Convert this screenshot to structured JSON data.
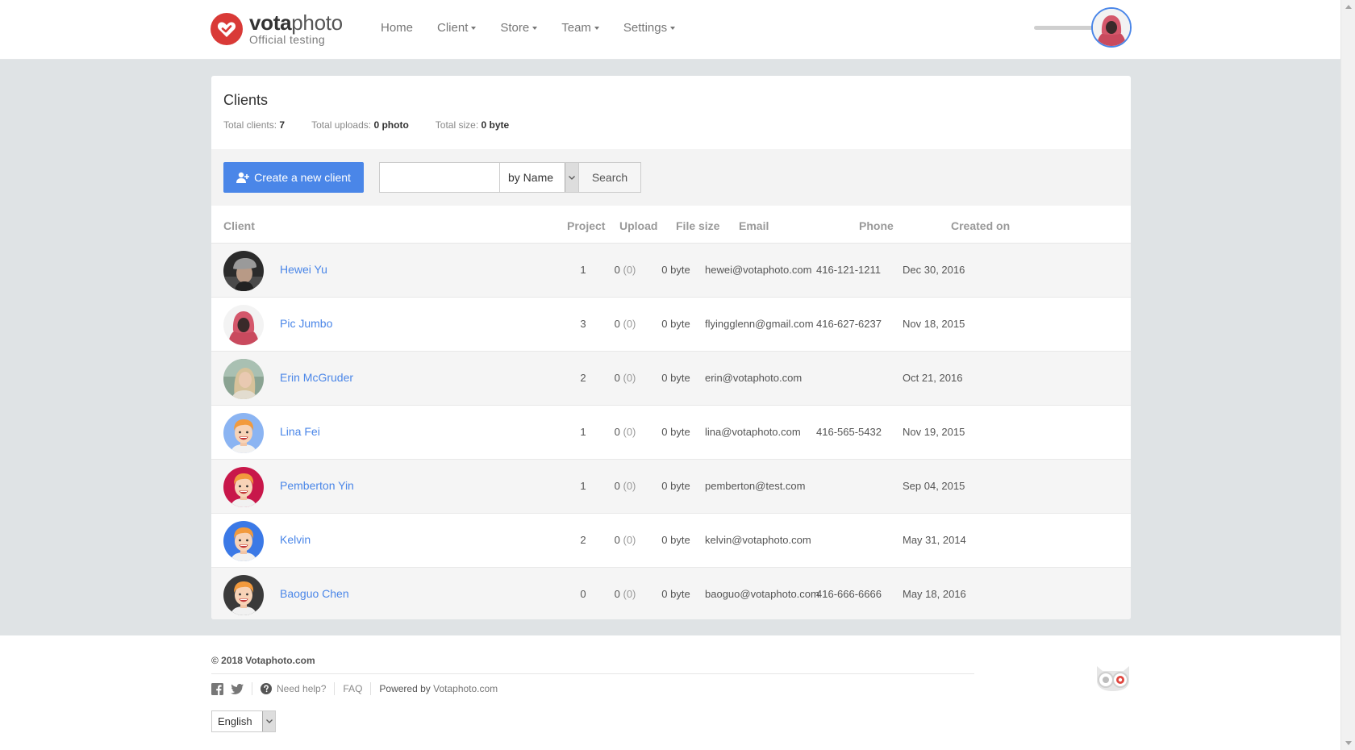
{
  "brand": {
    "name_bold": "vota",
    "name_light": "photo",
    "subtitle": "Official testing"
  },
  "nav": [
    {
      "label": "Home",
      "dropdown": false
    },
    {
      "label": "Client",
      "dropdown": true
    },
    {
      "label": "Store",
      "dropdown": true
    },
    {
      "label": "Team",
      "dropdown": true
    },
    {
      "label": "Settings",
      "dropdown": true
    }
  ],
  "page": {
    "title": "Clients",
    "stats": {
      "clients_label": "Total clients:",
      "clients_value": "7",
      "uploads_label": "Total uploads:",
      "uploads_value": "0 photo",
      "size_label": "Total size:",
      "size_value": "0 byte"
    }
  },
  "toolbar": {
    "create_label": "Create a new client",
    "search_value": "",
    "search_by": "by Name",
    "search_label": "Search"
  },
  "table": {
    "columns": [
      "Client",
      "Project",
      "Upload",
      "File size",
      "Email",
      "Phone",
      "Created on"
    ],
    "rows": [
      {
        "name": "Hewei Yu",
        "project": "1",
        "upload_count": "0",
        "upload_paren": "(0)",
        "file_size": "0 byte",
        "email": "hewei@votaphoto.com",
        "phone": "416-121-1211",
        "created": "Dec 30, 2016",
        "avatar": "photo-man-cap"
      },
      {
        "name": "Pic Jumbo",
        "project": "3",
        "upload_count": "0",
        "upload_paren": "(0)",
        "file_size": "0 byte",
        "email": "flyingglenn@gmail.com",
        "phone": "416-627-6237",
        "created": "Nov 18, 2015",
        "avatar": "photo-pink-hood"
      },
      {
        "name": "Erin McGruder",
        "project": "2",
        "upload_count": "0",
        "upload_paren": "(0)",
        "file_size": "0 byte",
        "email": "erin@votaphoto.com",
        "phone": "",
        "created": "Oct 21, 2016",
        "avatar": "photo-woman"
      },
      {
        "name": "Lina Fei",
        "project": "1",
        "upload_count": "0",
        "upload_paren": "(0)",
        "file_size": "0 byte",
        "email": "lina@votaphoto.com",
        "phone": "416-565-5432",
        "created": "Nov 19, 2015",
        "avatar": "cartoon-light-blue"
      },
      {
        "name": "Pemberton Yin",
        "project": "1",
        "upload_count": "0",
        "upload_paren": "(0)",
        "file_size": "0 byte",
        "email": "pemberton@test.com",
        "phone": "",
        "created": "Sep 04, 2015",
        "avatar": "cartoon-crimson"
      },
      {
        "name": "Kelvin",
        "project": "2",
        "upload_count": "0",
        "upload_paren": "(0)",
        "file_size": "0 byte",
        "email": "kelvin@votaphoto.com",
        "phone": "",
        "created": "May 31, 2014",
        "avatar": "cartoon-blue"
      },
      {
        "name": "Baoguo Chen",
        "project": "0",
        "upload_count": "0",
        "upload_paren": "(0)",
        "file_size": "0 byte",
        "email": "baoguo@votaphoto.com",
        "phone": "416-666-6666",
        "created": "May 18, 2016",
        "avatar": "cartoon-dark"
      }
    ]
  },
  "footer": {
    "copyright": "© 2018 Votaphoto.com",
    "help": "Need help?",
    "faq": "FAQ",
    "powered_prefix": "Powered by",
    "powered_brand": "Votaphoto.com",
    "language": "English",
    "social_icons": [
      "facebook-icon",
      "twitter-icon"
    ]
  },
  "colors": {
    "accent": "#4a86e8",
    "brand": "#d93a37",
    "page_bg": "#dfe3e5",
    "row_alt": "#f5f5f5"
  }
}
